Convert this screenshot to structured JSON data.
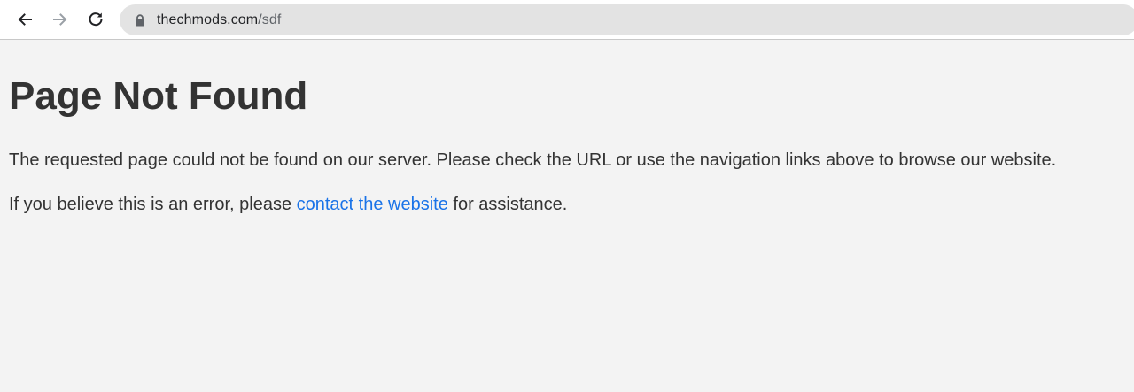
{
  "browser": {
    "url_host": "thechmods.com",
    "url_path": "/sdf",
    "icons": {
      "back": "arrow-left-icon",
      "forward": "arrow-right-icon",
      "reload": "reload-icon",
      "lock": "lock-icon"
    }
  },
  "page": {
    "title": "Page Not Found",
    "paragraph1": "The requested page could not be found on our server. Please check the URL or use the navigation links above to browse our website.",
    "paragraph2_prefix": "If you believe this is an error, please ",
    "paragraph2_link": "contact the website",
    "paragraph2_suffix": " for assistance."
  },
  "colors": {
    "page_background": "#f3f3f3",
    "text": "#333333",
    "link": "#1a73e8",
    "omnibox": "#e3e3e3"
  }
}
